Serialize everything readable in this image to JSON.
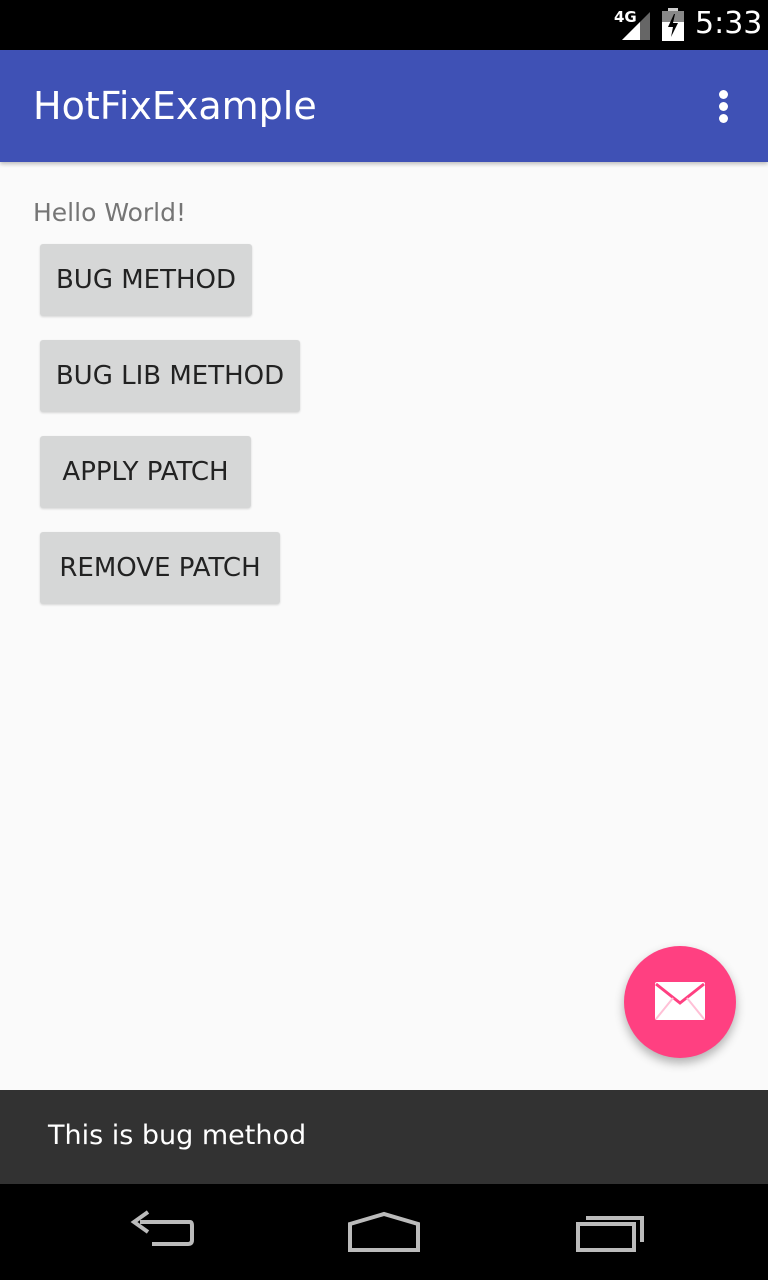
{
  "status_bar": {
    "network": "4G",
    "time": "5:33",
    "icons": [
      "signal-icon",
      "battery-icon"
    ]
  },
  "app_bar": {
    "title": "HotFixExample",
    "overflow_icon": "more-vert-icon"
  },
  "content": {
    "hello_text": "Hello World!",
    "buttons": [
      {
        "label": "BUG METHOD"
      },
      {
        "label": "BUG LIB METHOD"
      },
      {
        "label": "APPLY PATCH"
      },
      {
        "label": "REMOVE PATCH"
      }
    ]
  },
  "fab": {
    "icon": "mail-icon",
    "color": "#ff4081"
  },
  "snackbar": {
    "message": "This is bug method"
  },
  "nav_bar": {
    "icons": [
      "back-icon",
      "home-icon",
      "recents-icon"
    ]
  },
  "colors": {
    "primary": "#3f51b5",
    "accent": "#ff4081",
    "snackbar_bg": "#323232",
    "button_bg": "#d6d7d7"
  }
}
